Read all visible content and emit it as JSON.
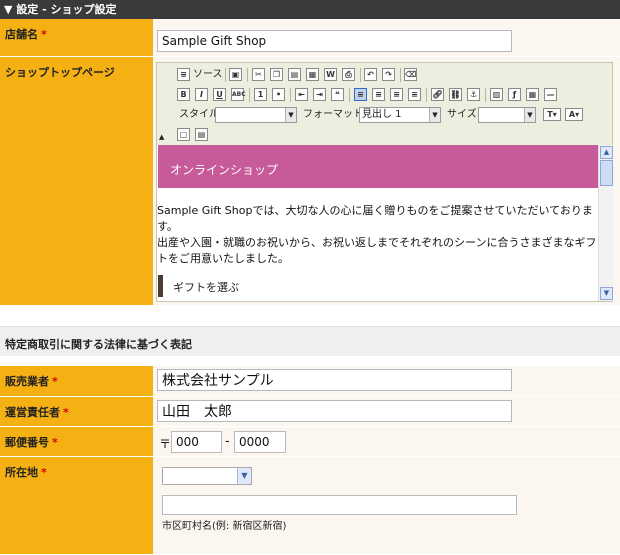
{
  "header": {
    "title": "▼ 設定 - ショップ設定"
  },
  "shop": {
    "name_label": "店舗名",
    "required": "*",
    "name_value": "Sample Gift Shop",
    "top_label": "ショップトップページ"
  },
  "editor": {
    "source_label": "ソース",
    "style_label": "スタイル",
    "format_label": "フォーマット",
    "format_value": "見出し 1",
    "size_label": "サイズ",
    "banner_text": "オンラインショップ",
    "paragraph": "Sample Gift Shopでは、大切な人の心に届く贈りものをご提案させていただいております。\n出産や入園・就職のお祝いから、お祝い返しまでそれぞれのシーンに合うさまざまなギフトをご用意いたしました。",
    "gift_heading": "ギフトを選ぶ"
  },
  "law": {
    "section_title": "特定商取引に関する法律に基づく表記",
    "seller_label": "販売業者",
    "seller_value": "株式会社サンプル",
    "manager_label": "運営責任者",
    "manager_value": "山田　太郎",
    "postal_label": "郵便番号",
    "postal_mark": "〒",
    "postal_1": "000",
    "postal_dash": "-",
    "postal_2": "0000",
    "address_label": "所在地",
    "prefecture_value": "",
    "city_value": "",
    "city_hint": "市区町村名(例: 新宿区新宿)"
  }
}
